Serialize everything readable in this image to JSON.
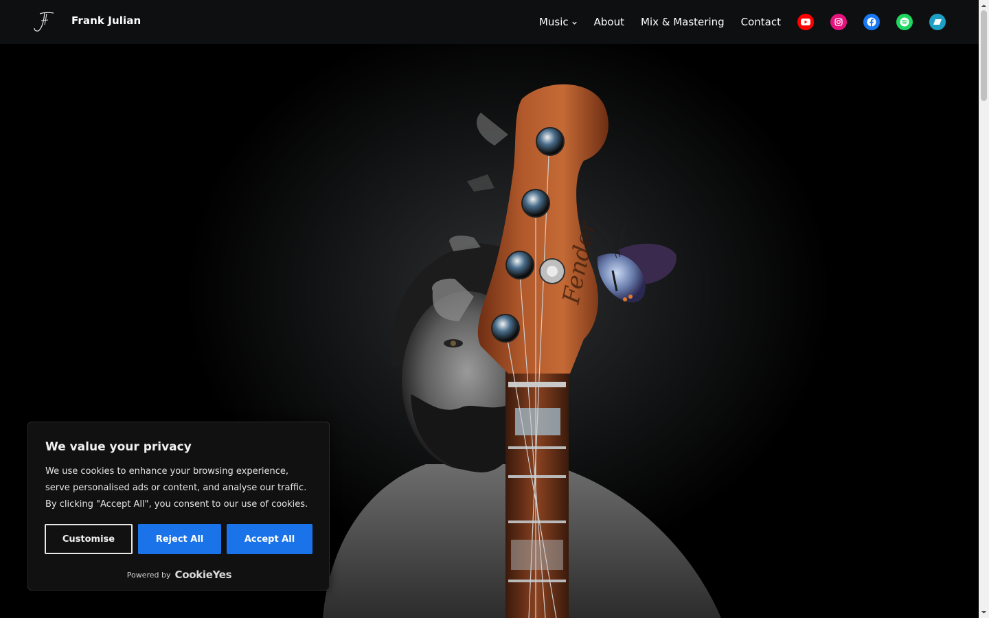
{
  "header": {
    "site_title": "Frank Julian",
    "nav": [
      "Music",
      "About",
      "Mix & Mastering",
      "Contact"
    ],
    "social": [
      {
        "name": "youtube",
        "color": "#ff0000"
      },
      {
        "name": "instagram",
        "color": "#e4137e"
      },
      {
        "name": "facebook",
        "color": "#1877f2"
      },
      {
        "name": "spotify",
        "color": "#1ed760"
      },
      {
        "name": "bandcamp",
        "color": "#1da0c3"
      }
    ]
  },
  "cookie": {
    "title": "We value your privacy",
    "text": "We use cookies to enhance your browsing experience, serve personalised ads or content, and analyse our traffic. By clicking \"Accept All\", you consent to our use of cookies.",
    "customise_label": "Customise",
    "reject_label": "Reject All",
    "accept_label": "Accept All",
    "powered_by_label": "Powered by",
    "powered_by_brand": "CookieYes"
  },
  "hero": {
    "headstock_text": "Fender"
  }
}
